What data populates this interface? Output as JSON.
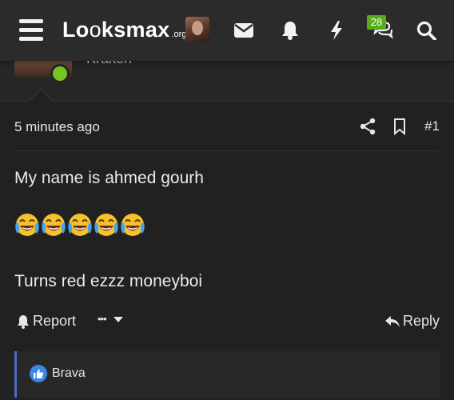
{
  "header": {
    "logo_main_bold": "Lo",
    "logo_main_mid": "o",
    "logo_main_rest": "ksmax",
    "logo_sub": ".org",
    "badge_count": "28",
    "icons": [
      "menu-icon",
      "mail-icon",
      "bell-icon",
      "lightning-icon",
      "chat-icon",
      "search-icon"
    ]
  },
  "author": {
    "name": "Kraken",
    "status_color": "#77c51f"
  },
  "post": {
    "time": "5 minutes ago",
    "number": "#1",
    "line1": "My name is ahmed gourh",
    "emoji_count": 5,
    "emoji_name": "joy-emoji",
    "line2": "Turns red ezzz moneyboi"
  },
  "actions": {
    "report": "Report",
    "more": "•••",
    "reply": "Reply"
  },
  "reactions": {
    "user": "Brava",
    "reaction_icon": "thumbs-up-icon"
  },
  "colors": {
    "accent_green": "#5aab1c",
    "reaction_bar": "#5567c8",
    "like_blue": "#3b86e6"
  }
}
